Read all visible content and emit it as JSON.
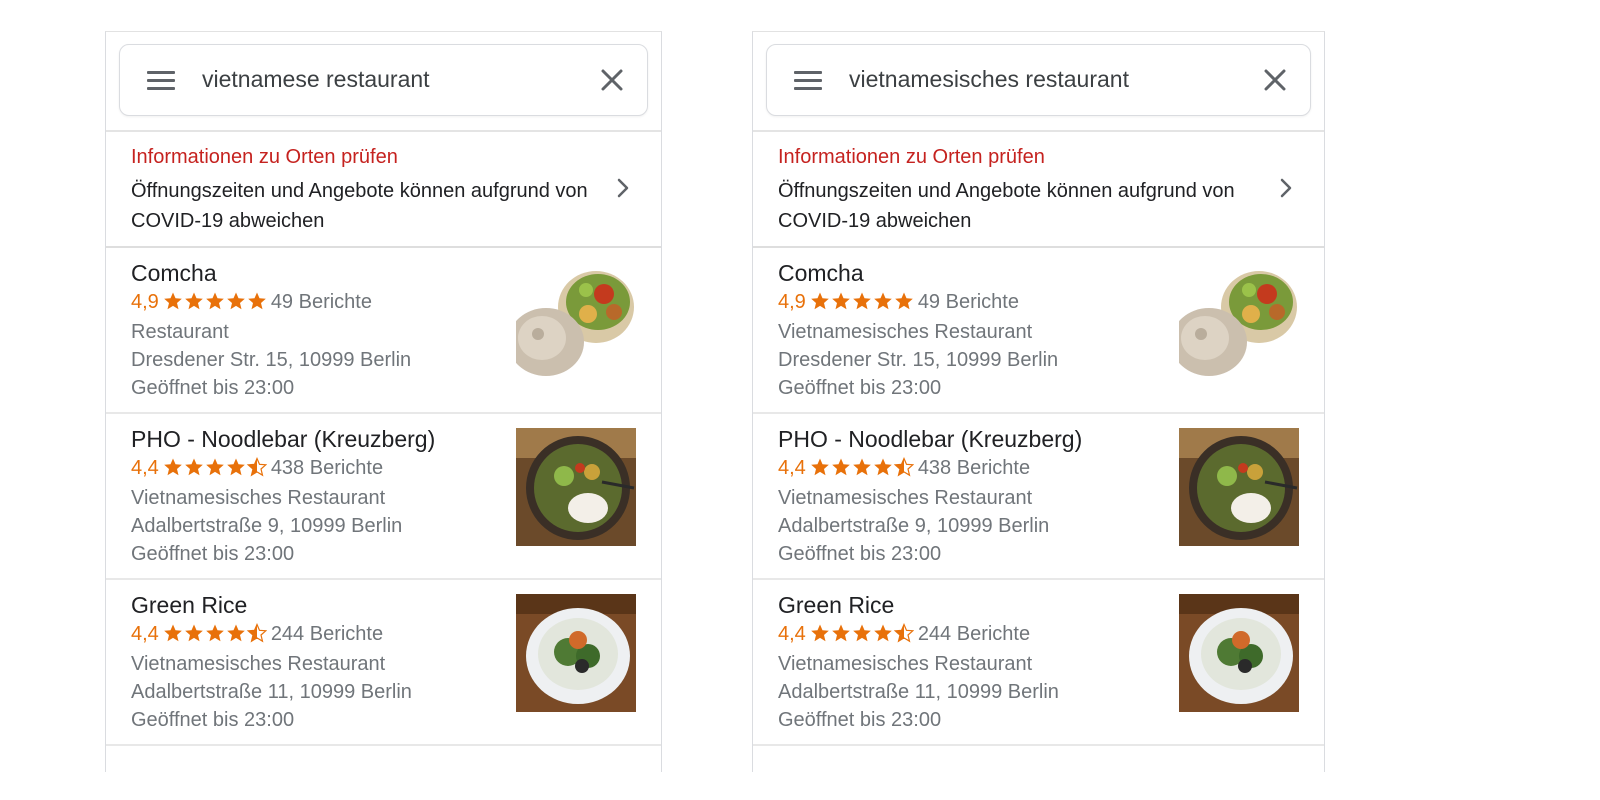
{
  "colors": {
    "star": "#e8710a",
    "info_title": "#c5221f",
    "secondary_text": "#70757a"
  },
  "panels": [
    {
      "search": {
        "value": "vietnamese restaurant"
      },
      "notice": {
        "title": "Informationen zu Orten prüfen",
        "text": "Öffnungszeiten und Angebote können aufgrund von COVID-19 abweichen"
      },
      "results": [
        {
          "name": "Comcha",
          "rating": "4,9",
          "stars": 5,
          "reviews": "49 Berichte",
          "category": "Restaurant",
          "address": "Dresdener Str. 15, 10999 Berlin",
          "hours": "Geöffnet bis 23:00"
        },
        {
          "name": "PHO - Noodlebar (Kreuzberg)",
          "rating": "4,4",
          "stars": 4.5,
          "reviews": "438 Berichte",
          "category": "Vietnamesisches Restaurant",
          "address": "Adalbertstraße 9, 10999 Berlin",
          "hours": "Geöffnet bis 23:00"
        },
        {
          "name": "Green Rice",
          "rating": "4,4",
          "stars": 4.5,
          "reviews": "244 Berichte",
          "category": "Vietnamesisches Restaurant",
          "address": "Adalbertstraße 11, 10999 Berlin",
          "hours": "Geöffnet bis 23:00"
        }
      ]
    },
    {
      "search": {
        "value": "vietnamesisches restaurant"
      },
      "notice": {
        "title": "Informationen zu Orten prüfen",
        "text": "Öffnungszeiten und Angebote können aufgrund von COVID-19 abweichen"
      },
      "results": [
        {
          "name": "Comcha",
          "rating": "4,9",
          "stars": 5,
          "reviews": "49 Berichte",
          "category": "Vietnamesisches Restaurant",
          "address": "Dresdener Str. 15, 10999 Berlin",
          "hours": "Geöffnet bis 23:00"
        },
        {
          "name": "PHO - Noodlebar (Kreuzberg)",
          "rating": "4,4",
          "stars": 4.5,
          "reviews": "438 Berichte",
          "category": "Vietnamesisches Restaurant",
          "address": "Adalbertstraße 9, 10999 Berlin",
          "hours": "Geöffnet bis 23:00"
        },
        {
          "name": "Green Rice",
          "rating": "4,4",
          "stars": 4.5,
          "reviews": "244 Berichte",
          "category": "Vietnamesisches Restaurant",
          "address": "Adalbertstraße 11, 10999 Berlin",
          "hours": "Geöffnet bis 23:00"
        }
      ]
    }
  ]
}
